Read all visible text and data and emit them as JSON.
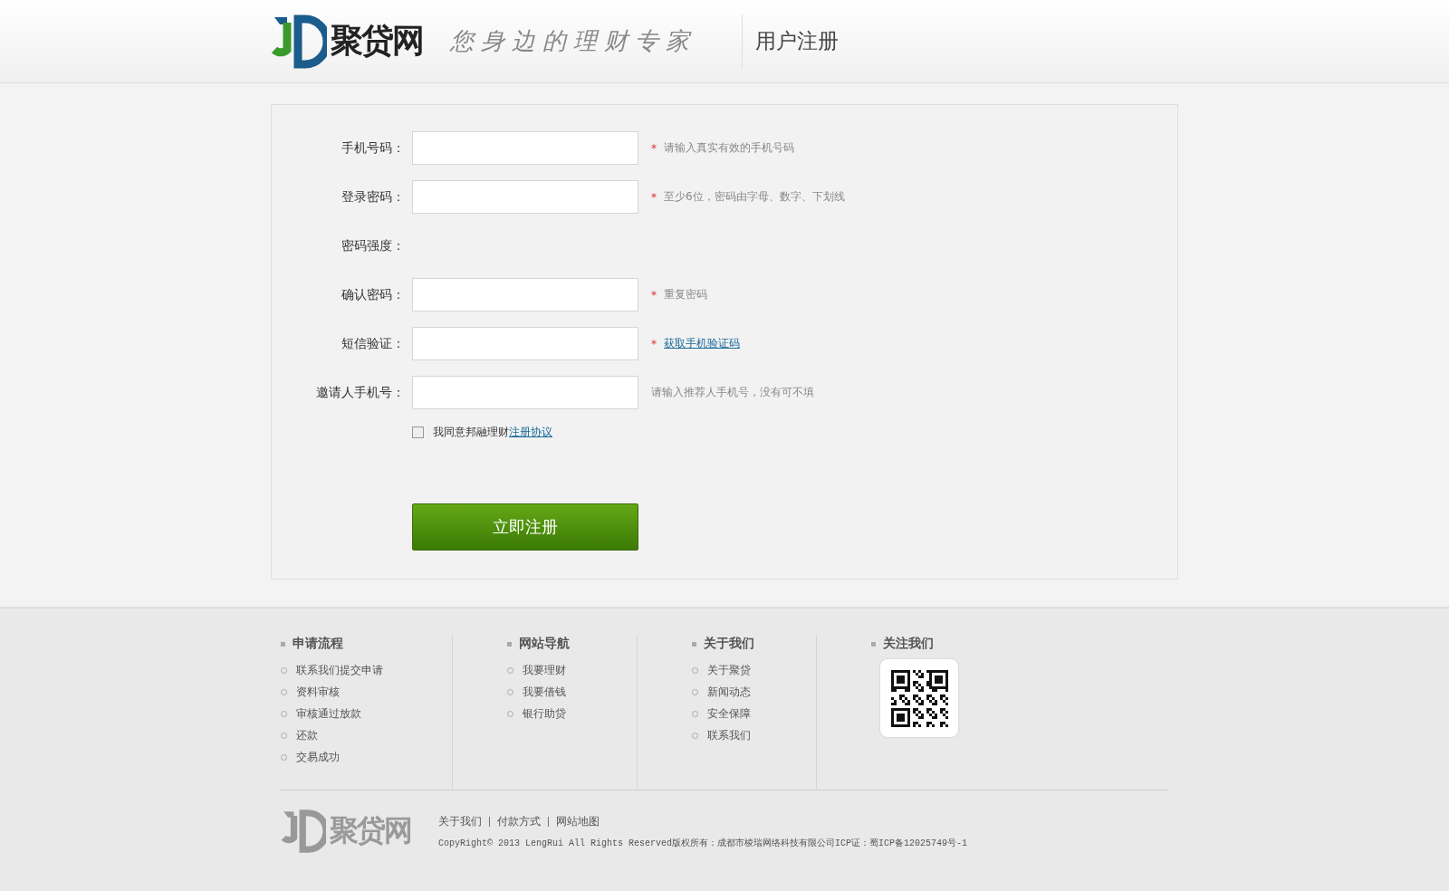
{
  "header": {
    "logo_text": "聚贷网",
    "slogan": "您身边的理财专家",
    "page_title": "用户注册"
  },
  "form": {
    "rows": [
      {
        "kind": "input",
        "label": "手机号码：",
        "mark": "*",
        "hint": "请输入真实有效的手机号码",
        "hint_is_link": false
      },
      {
        "kind": "input",
        "label": "登录密码：",
        "mark": "*",
        "hint": "至少6位，密码由字母、数字、下划线",
        "hint_is_link": false
      },
      {
        "kind": "strength",
        "label": "密码强度："
      },
      {
        "kind": "input",
        "label": "确认密码：",
        "mark": "*",
        "hint": "重复密码",
        "hint_is_link": false
      },
      {
        "kind": "input",
        "label": "短信验证：",
        "mark": "*",
        "hint": "获取手机验证码",
        "hint_is_link": true
      },
      {
        "kind": "input",
        "label": "邀请人手机号：",
        "hint": "请输入推荐人手机号，没有可不填",
        "hint_is_link": false
      }
    ],
    "agree": {
      "checked": false,
      "text": "我同意邦融理财",
      "link": "注册协议"
    },
    "submit": "立即注册"
  },
  "footer": {
    "columns": [
      {
        "title": "申请流程",
        "items": [
          "联系我们提交申请",
          "资料审核",
          "审核通过放款",
          "还款",
          "交易成功"
        ]
      },
      {
        "title": "网站导航",
        "items": [
          "我要理财",
          "我要借钱",
          "银行助贷"
        ]
      },
      {
        "title": "关于我们",
        "items": [
          "关于聚贷",
          "新闻动态",
          "安全保障",
          "联系我们"
        ]
      },
      {
        "title": "关注我们"
      }
    ],
    "logo_text": "聚贷网",
    "links": [
      "关于我们",
      "付款方式",
      "网站地图"
    ],
    "copyright": "CopyRight© 2013 LengRui All Rights Reserved版权所有：成都市棱瑞网络科技有限公司ICP证：蜀ICP备12025749号-1"
  }
}
